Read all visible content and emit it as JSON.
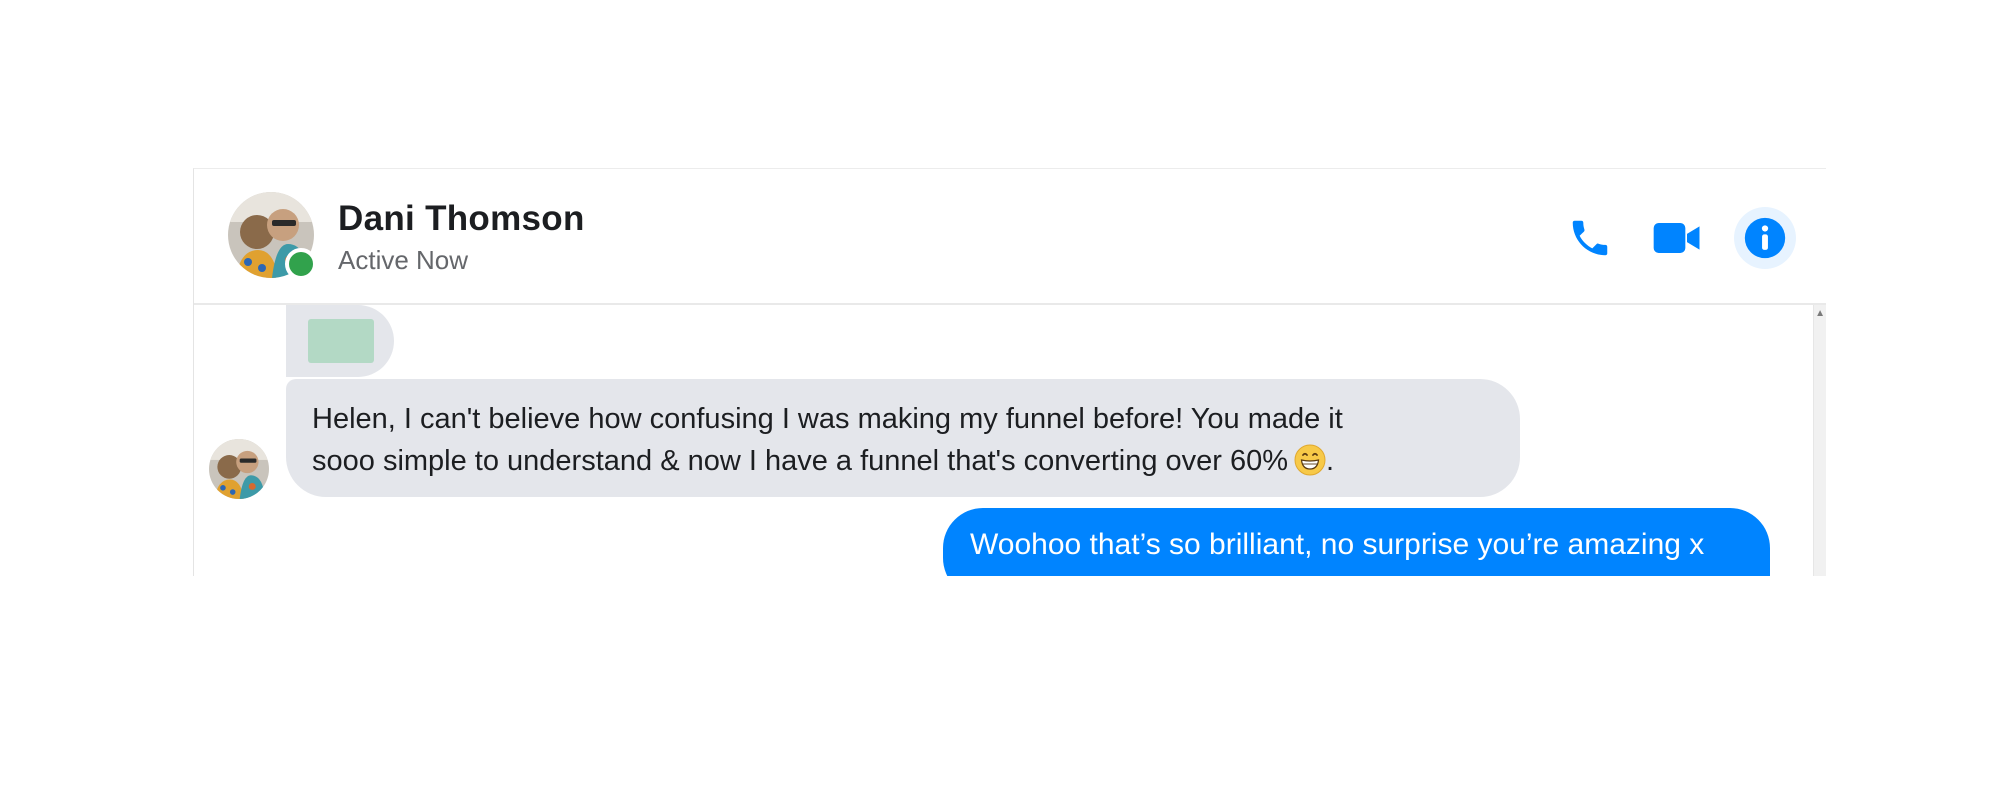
{
  "contact": {
    "name": "Dani Thomson",
    "status": "Active Now"
  },
  "header_actions": [
    {
      "icon": "phone-icon",
      "label": "Audio call"
    },
    {
      "icon": "video-camera-icon",
      "label": "Video call"
    },
    {
      "icon": "info-icon",
      "label": "Conversation information"
    }
  ],
  "messages": [
    {
      "direction": "incoming",
      "type": "attachment",
      "icon": "image-thumbnail-icon"
    },
    {
      "direction": "incoming",
      "type": "text",
      "lines": [
        "Helen, I can't believe how confusing I was making my funnel before! You made it",
        "sooo simple to understand & now I have a funnel that's converting over 60%"
      ],
      "emoji": "grinning-face-icon",
      "trailing": "."
    },
    {
      "direction": "outgoing",
      "type": "text",
      "text": "Woohoo that’s so brilliant, no surprise you’re amazing x"
    }
  ],
  "colors": {
    "accent": "#0084ff",
    "incoming_bubble": "#e4e6eb",
    "online": "#31a24c",
    "name_text": "#1c1e21",
    "status_text": "#65676b",
    "info_bg": "#e7f3ff"
  }
}
